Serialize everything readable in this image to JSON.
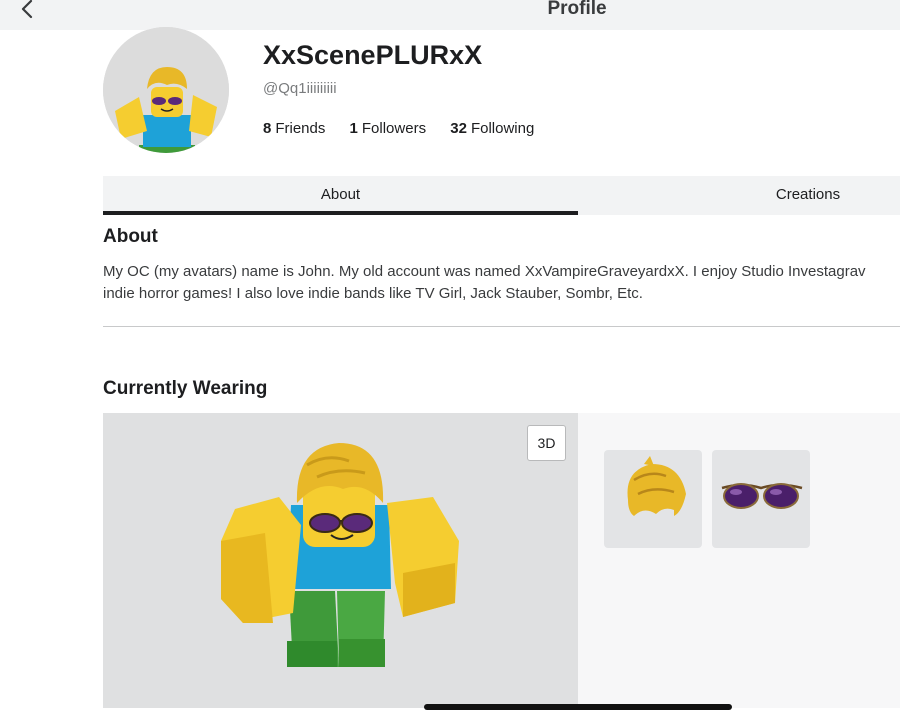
{
  "header": {
    "title": "Profile",
    "back_icon": "chevron-left-icon"
  },
  "profile": {
    "display_name": "XxScenePLURxX",
    "username": "@Qq1iiiiiiiii",
    "stats": [
      {
        "count": "8",
        "label": "Friends"
      },
      {
        "count": "1",
        "label": "Followers"
      },
      {
        "count": "32",
        "label": "Following"
      }
    ]
  },
  "tabs": [
    {
      "label": "About",
      "active": true
    },
    {
      "label": "Creations",
      "active": false
    }
  ],
  "about": {
    "heading": "About",
    "lines": [
      "My OC (my avatars) name is John. My old account was named XxVampireGraveyardxX. I enjoy Studio Investagrav",
      "indie horror games! I also love indie bands like TV Girl, Jack Stauber, Sombr, Etc."
    ]
  },
  "wearing": {
    "heading": "Currently Wearing",
    "view_toggle_label": "3D",
    "items": [
      {
        "icon": "blonde-hair-icon"
      },
      {
        "icon": "sunglasses-icon"
      }
    ]
  },
  "colors": {
    "accent": "#1d1e20",
    "skin_yellow": "#f5cd30",
    "torso_blue": "#1ea2d8",
    "legs_green": "#3f9a3a",
    "hair_gold": "#e8b828",
    "lens_purple": "#5a2a7a"
  }
}
